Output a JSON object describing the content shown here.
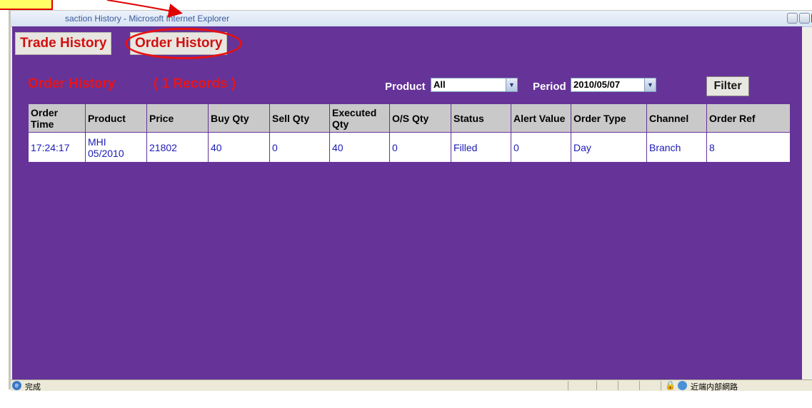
{
  "window": {
    "title": "saction History - Microsoft Internet Explorer"
  },
  "tabs": [
    {
      "label": "Trade History"
    },
    {
      "label": "Order History"
    }
  ],
  "header": {
    "heading": "Order History",
    "records": "( 1 Records )"
  },
  "filters": {
    "product_label": "Product",
    "product_value": "All",
    "period_label": "Period",
    "period_value": "2010/05/07",
    "filter_button": "Filter"
  },
  "table": {
    "columns": [
      "Order Time",
      "Product",
      "Price",
      "Buy Qty",
      "Sell Qty",
      "Executed Qty",
      "O/S Qty",
      "Status",
      "Alert Value",
      "Order Type",
      "Channel",
      "Order Ref"
    ],
    "rows": [
      [
        "17:24:17",
        "MHI 05/2010",
        "21802",
        "40",
        "0",
        "40",
        "0",
        "Filled",
        "0",
        "Day",
        "Branch",
        "8"
      ]
    ]
  },
  "statusbar": {
    "text": "完成",
    "zone": "近端内部網路"
  },
  "colors": {
    "content_bg": "#663399",
    "accent_red": "#e8141a",
    "callout_yellow": "#ffff66"
  }
}
